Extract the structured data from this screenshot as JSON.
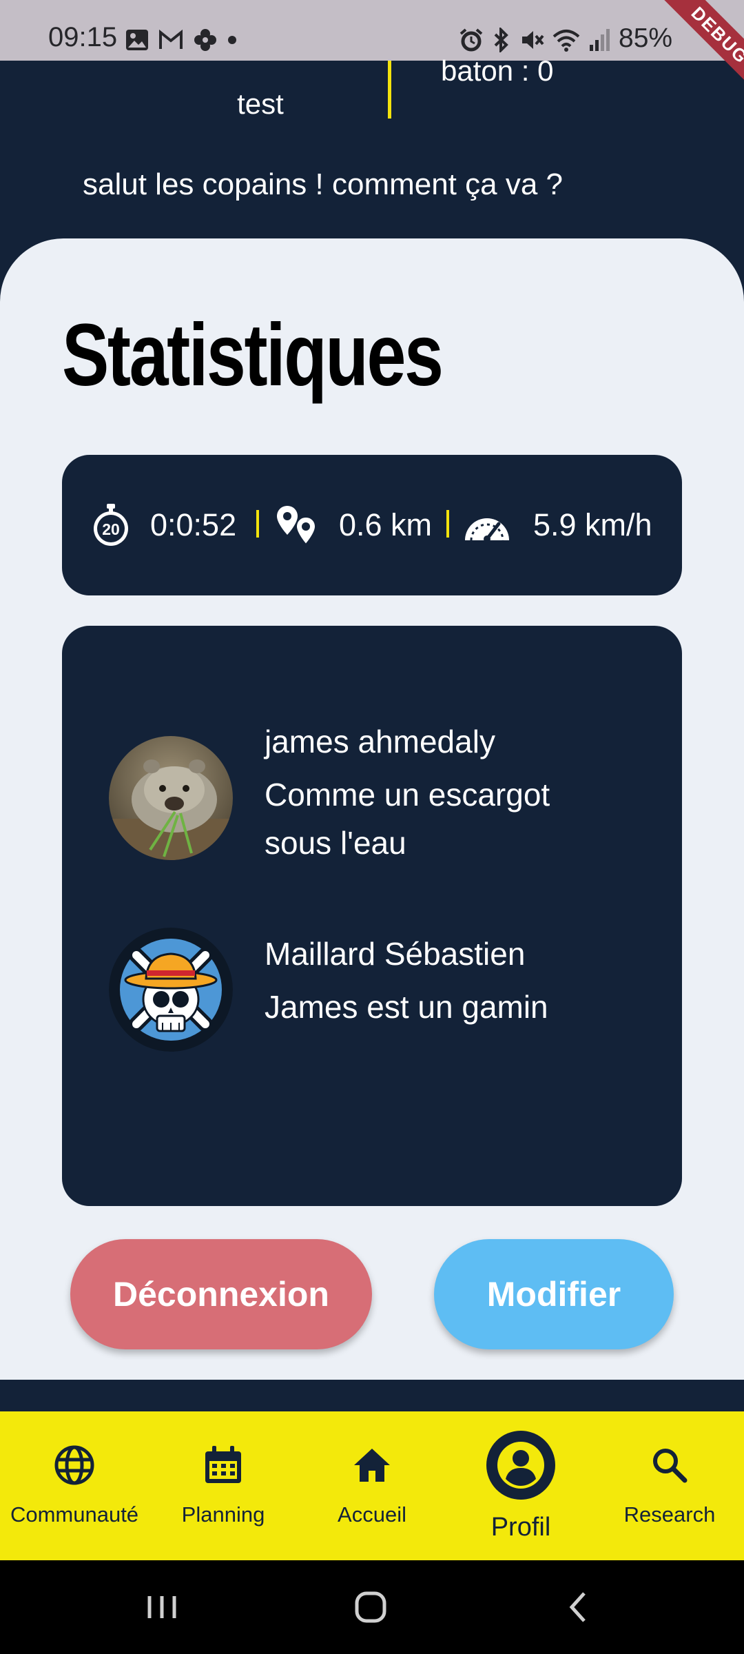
{
  "status_bar": {
    "time": "09:15",
    "battery": "85%",
    "debug_banner": "DEBUG"
  },
  "profile": {
    "name": "test",
    "baton": "baton : 0",
    "bio": "salut les copains ! comment ça va ?"
  },
  "stats": {
    "title": "Statistiques",
    "duration": "0:0:52",
    "distance": "0.6 km",
    "speed": "5.9 km/h"
  },
  "comments": [
    {
      "author": "james ahmedaly",
      "text": "Comme un escargot sous l'eau",
      "avatar": "wombat-photo"
    },
    {
      "author": "Maillard Sébastien",
      "text": "James est un gamin",
      "avatar": "straw-hat-jolly-roger"
    }
  ],
  "buttons": {
    "logout": "Déconnexion",
    "edit": "Modifier"
  },
  "nav": {
    "items": [
      {
        "label": "Communauté",
        "icon": "globe-icon"
      },
      {
        "label": "Planning",
        "icon": "calendar-icon"
      },
      {
        "label": "Accueil",
        "icon": "home-icon"
      },
      {
        "label": "Profil",
        "icon": "person-icon",
        "active": true
      },
      {
        "label": "Research",
        "icon": "search-icon"
      }
    ]
  },
  "colors": {
    "navy": "#132238",
    "accent_yellow": "#f3e90b",
    "card_bg": "#ecf0f6",
    "logout_red": "#d76e76",
    "edit_blue": "#5ebdf3"
  }
}
